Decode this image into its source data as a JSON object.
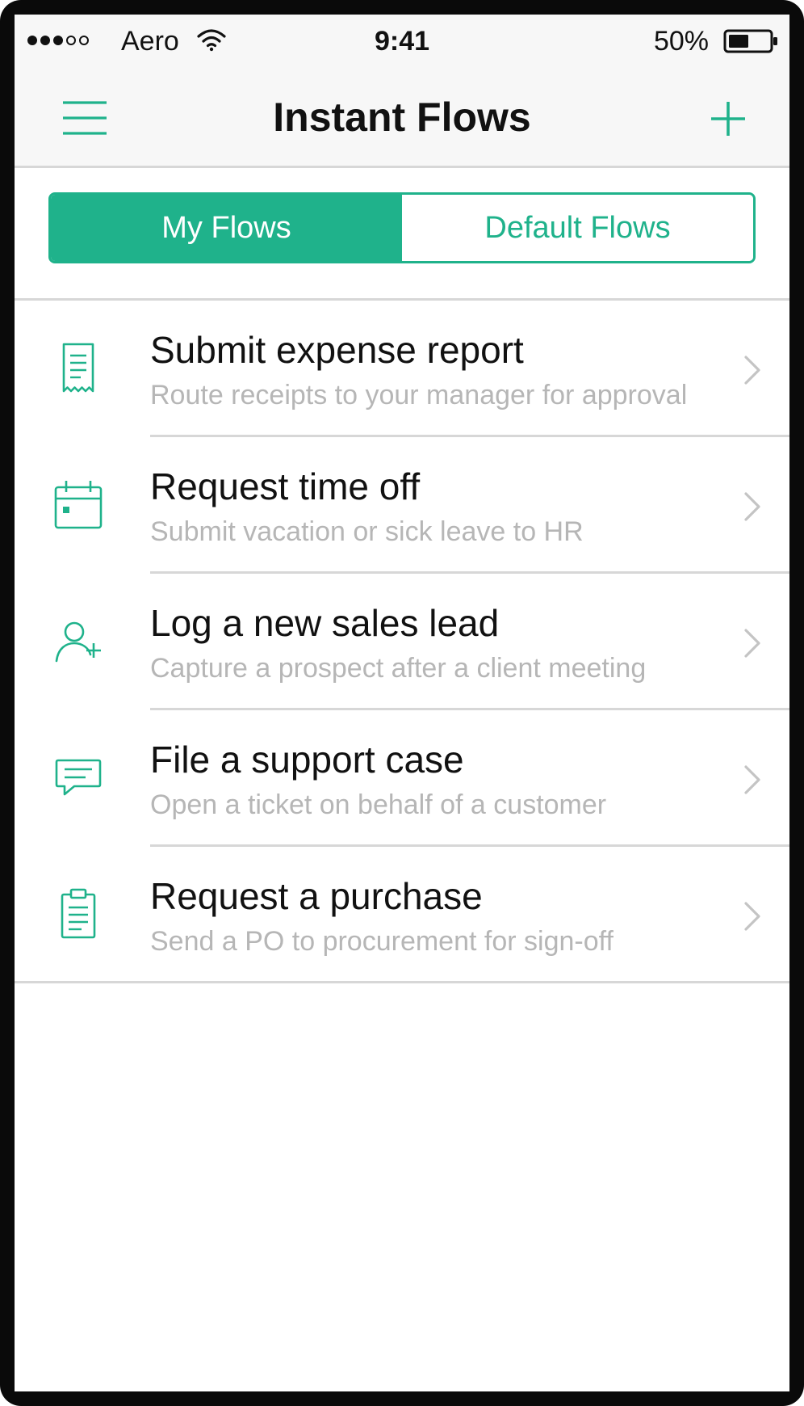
{
  "colors": {
    "accent": "#1fb28b",
    "text": "#111111",
    "subtitle": "#b6b6b6",
    "divider": "#d7d7d7",
    "bar_background": "#f7f7f7"
  },
  "status_bar": {
    "carrier": "Aero",
    "time": "9:41",
    "battery_percent": "50%",
    "signal_strength": 3,
    "signal_max": 5,
    "battery_level": 0.5
  },
  "nav": {
    "title": "Instant Flows",
    "left_icon": "menu-icon",
    "right_icon": "plus-icon"
  },
  "segments": {
    "items": [
      {
        "label": "My Flows",
        "selected": true
      },
      {
        "label": "Default Flows",
        "selected": false
      }
    ]
  },
  "flows": [
    {
      "title": "Submit expense report",
      "subtitle": "Route receipts to your manager for approval",
      "icon": "receipt-icon"
    },
    {
      "title": "Request time off",
      "subtitle": "Submit vacation or sick leave to HR",
      "icon": "calendar-icon"
    },
    {
      "title": "Log a new sales lead",
      "subtitle": "Capture a prospect after a client meeting",
      "icon": "add-user-icon"
    },
    {
      "title": "File a support case",
      "subtitle": "Open a ticket on behalf of a customer",
      "icon": "chat-icon"
    },
    {
      "title": "Request a purchase",
      "subtitle": "Send a PO to procurement for sign-off",
      "icon": "clipboard-icon"
    }
  ]
}
